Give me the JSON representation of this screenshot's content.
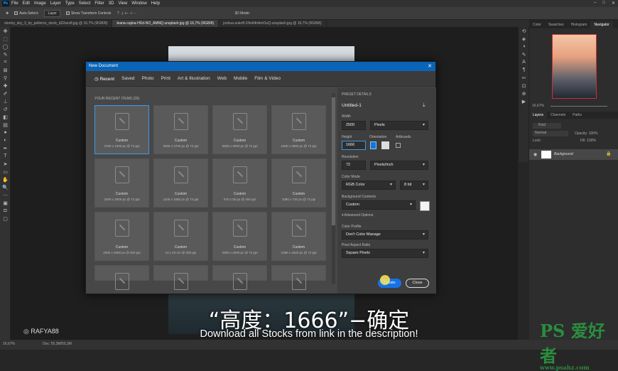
{
  "menu": {
    "items": [
      "File",
      "Edit",
      "Image",
      "Layer",
      "Type",
      "Select",
      "Filter",
      "3D",
      "View",
      "Window",
      "Help"
    ]
  },
  "options": {
    "auto_select": "Auto-Select:",
    "layer": "Layer",
    "transform": "Show Transform Controls",
    "mode3d": "3D Mode:"
  },
  "tabs": [
    "stormy_sky_3_by_pelleron_stock_d22sex8.jpg @ 16,7% (RGB/8)",
    "leana-cajina-HDd-NO_AMNQ unsplash.jpg @ 16,7% (RGB/8)",
    "joshua-sukoff-1NoIt4hAmOuQ-unsplash.jpg @ 16,7% (RGB/8)"
  ],
  "status": {
    "zoom": "16,67%",
    "doc": "Doc: 55,3M/55,3M"
  },
  "right_panel": {
    "tabs": [
      "Color",
      "Swatches",
      "Histogram",
      "Navigator"
    ],
    "zoom": "16,67%",
    "layer_tabs": [
      "Layers",
      "Channels",
      "Paths"
    ],
    "kind": "Kind",
    "blend": "Normal",
    "opacity": "Opacity: 100%",
    "lock": "Lock:",
    "fill": "Fill: 100%",
    "layer_name": "Background"
  },
  "dialog": {
    "title": "New Document",
    "tabs": [
      "Recent",
      "Saved",
      "Photo",
      "Print",
      "Art & Illustration",
      "Web",
      "Mobile",
      "Film & Video"
    ],
    "recent_head": "YOUR RECENT ITEMS  (20)",
    "tiles": [
      {
        "name": "Custom",
        "sub": "2700 x 1000 px @ 72 ppi"
      },
      {
        "name": "Custom",
        "sub": "3000 x 2700 px @ 72 ppi"
      },
      {
        "name": "Custom",
        "sub": "3000 x 3000 px @ 72 ppi"
      },
      {
        "name": "Custom",
        "sub": "1900 x 2800 px @ 72 ppi"
      },
      {
        "name": "Custom",
        "sub": "2400 x 2500 px @ 72 ppi"
      },
      {
        "name": "Custom",
        "sub": "1100 x 1080 px @ 72 ppi"
      },
      {
        "name": "Custom",
        "sub": "570 x 50 px @ 300 ppi"
      },
      {
        "name": "Custom",
        "sub": "1080 x 720 px @ 72 ppi"
      },
      {
        "name": "Custom",
        "sub": "2600 x 3000 px @ 300 ppi"
      },
      {
        "name": "Custom",
        "sub": "14 x 10 cm @ 300 ppi"
      },
      {
        "name": "Custom",
        "sub": "2000 x 2000 px @ 72 ppi"
      },
      {
        "name": "Custom",
        "sub": "1080 x 1920 px @ 72 ppi"
      },
      {
        "name": "",
        "sub": ""
      },
      {
        "name": "",
        "sub": ""
      },
      {
        "name": "",
        "sub": ""
      },
      {
        "name": "",
        "sub": ""
      }
    ],
    "preset_details": "PRESET DETAILS",
    "doc_name": "Untitled-1",
    "width_label": "Width",
    "width": "2500",
    "width_unit": "Pixels",
    "height_label": "Height",
    "height": "1666",
    "orientation": "Orientation",
    "artboards": "Artboards",
    "resolution_label": "Resolution",
    "resolution": "72",
    "resolution_unit": "Pixels/Inch",
    "color_mode_label": "Color Mode",
    "color_mode": "RGB Color",
    "bit": "8 bit",
    "bg_label": "Background Contents",
    "bg": "Custom",
    "advanced": "Advanced Options",
    "profile_label": "Color Profile",
    "profile": "Don't Color Manage",
    "aspect_label": "Pixel Aspect Ratio",
    "aspect": "Square Pixels",
    "create": "Create",
    "close": "Close"
  },
  "overlay": {
    "subtitle": "“高度：1666”−确定",
    "caption": "Download all Stocks from link in the description!",
    "channel": "RAFYA88",
    "watermark": "PS 爱好者",
    "watermark_url": "www.psahz.com"
  }
}
